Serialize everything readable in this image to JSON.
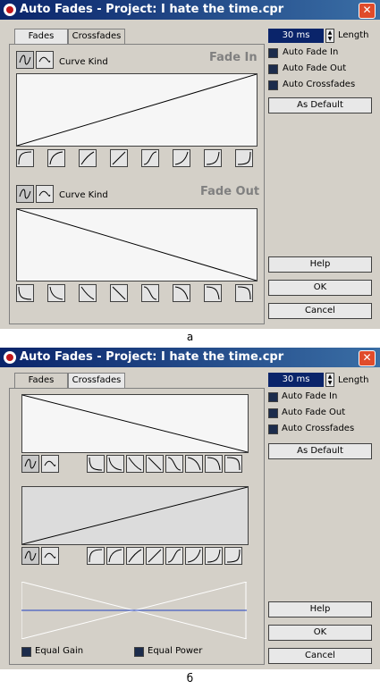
{
  "window_a": {
    "title": "Auto Fades - Project: I hate the time.cpr",
    "close": "✕",
    "tabs": [
      "Fades",
      "Crossfades"
    ],
    "curve_kind_label": "Curve Kind",
    "fade_in_label": "Fade In",
    "fade_out_label": "Fade Out",
    "length_value": "30 ms",
    "length_label": "Length",
    "checkboxes": [
      "Auto Fade In",
      "Auto Fade Out",
      "Auto Crossfades"
    ],
    "as_default": "As Default",
    "help": "Help",
    "ok": "OK",
    "cancel": "Cancel"
  },
  "caption_a": "a",
  "window_b": {
    "title": "Auto Fades - Project: I hate the time.cpr",
    "close": "✕",
    "tabs": [
      "Fades",
      "Crossfades"
    ],
    "length_value": "30 ms",
    "length_label": "Length",
    "checkboxes": [
      "Auto Fade In",
      "Auto Fade Out",
      "Auto Crossfades"
    ],
    "as_default": "As Default",
    "help": "Help",
    "ok": "OK",
    "cancel": "Cancel",
    "equal_gain": "Equal Gain",
    "equal_power": "Equal Power"
  },
  "caption_b": "б"
}
